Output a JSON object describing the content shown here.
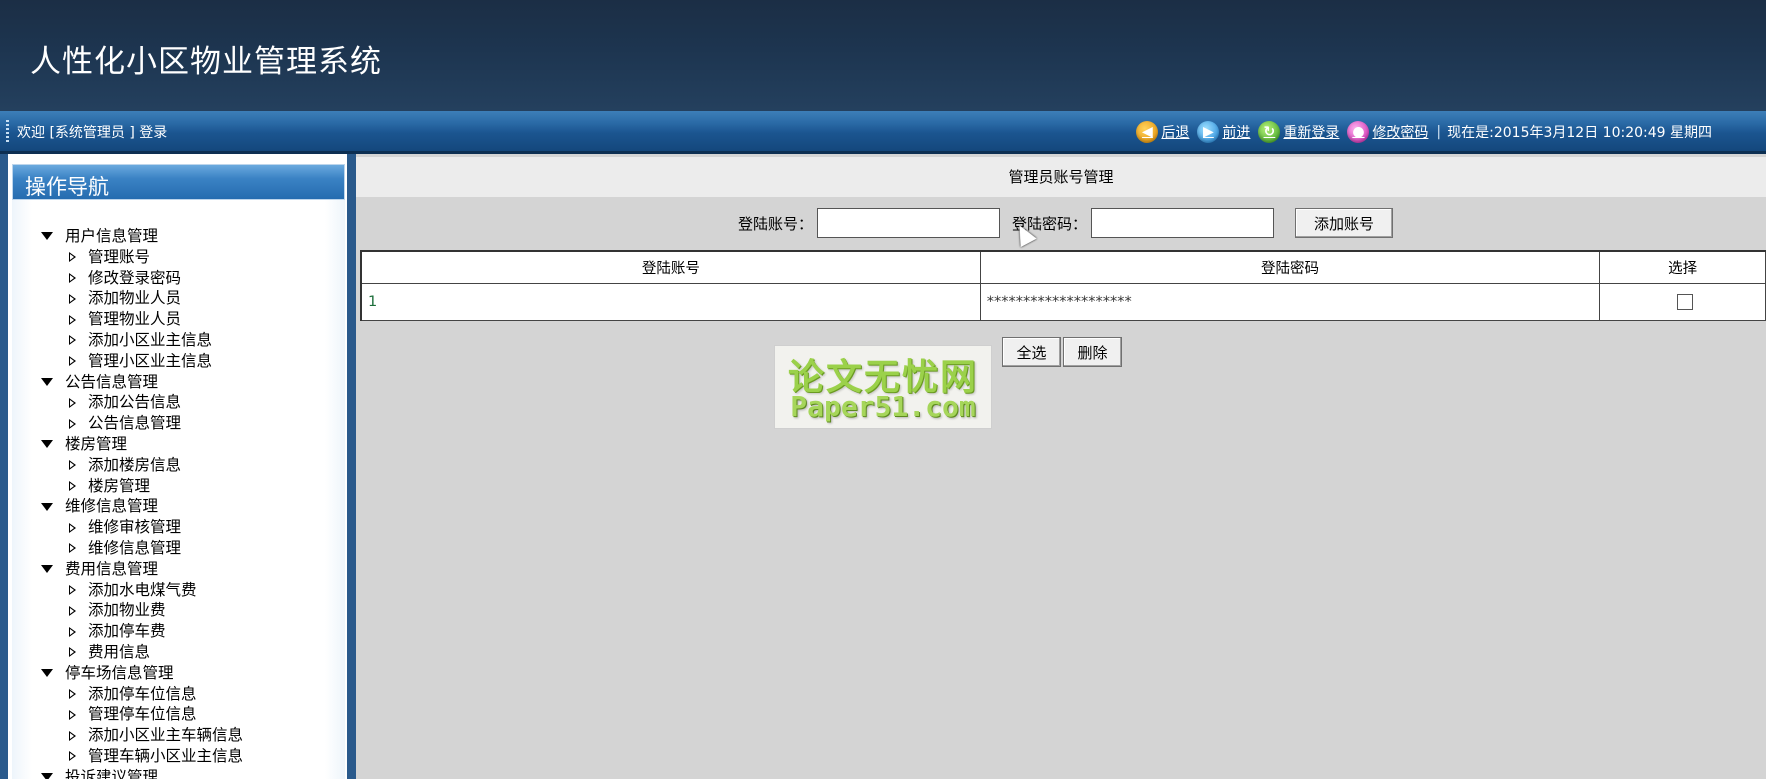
{
  "app": {
    "title": "人性化小区物业管理系统"
  },
  "topbar": {
    "welcome": "欢迎 [系统管理员 ] 登录",
    "back": "后退",
    "forward": "前进",
    "relogin": "重新登录",
    "change_password": "修改密码",
    "separator": "|",
    "now_text": "现在是:2015年3月12日 10:20:49 星期四"
  },
  "sidebar": {
    "title": "操作导航",
    "groups": [
      {
        "title": "用户信息管理",
        "items": [
          "管理账号",
          "修改登录密码",
          "添加物业人员",
          "管理物业人员",
          "添加小区业主信息",
          "管理小区业主信息"
        ]
      },
      {
        "title": "公告信息管理",
        "items": [
          "添加公告信息",
          "公告信息管理"
        ]
      },
      {
        "title": "楼房管理",
        "items": [
          "添加楼房信息",
          "楼房管理"
        ]
      },
      {
        "title": "维修信息管理",
        "items": [
          "维修审核管理",
          "维修信息管理"
        ]
      },
      {
        "title": "费用信息管理",
        "items": [
          "添加水电煤气费",
          "添加物业费",
          "添加停车费",
          "费用信息"
        ]
      },
      {
        "title": "停车场信息管理",
        "items": [
          "添加停车位信息",
          "管理停车位信息",
          "添加小区业主车辆信息",
          "管理车辆小区业主信息"
        ]
      },
      {
        "title": "投诉建议管理",
        "items": []
      }
    ]
  },
  "main": {
    "page_title": "管理员账号管理",
    "form": {
      "account_label": "登陆账号：",
      "account_value": "",
      "password_label": "登陆密码：",
      "password_value": "",
      "add_button": "添加账号"
    },
    "table": {
      "headers": [
        "登陆账号",
        "登陆密码",
        "选择"
      ],
      "rows": [
        {
          "account": "1",
          "password": "********************",
          "checked": false
        }
      ]
    },
    "select_all_button": "全选",
    "delete_button": "删除"
  },
  "watermark": {
    "line1": "论文无忧网",
    "line2": "Paper51.com"
  }
}
